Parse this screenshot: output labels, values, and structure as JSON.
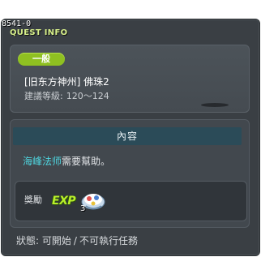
{
  "window": {
    "quest_id": "8541-0",
    "title": "QUEST INFO"
  },
  "quest": {
    "badge": "一般",
    "name": "[旧东方神州] 佛珠2",
    "level_label": "建議等級:",
    "level_value": "120～124"
  },
  "content": {
    "header": "內容",
    "npc": "海峰法师",
    "description_rest": "需要幫助。"
  },
  "reward": {
    "label": "獎勵",
    "exp_label": "EXP",
    "item_icon": "reward-item-icon",
    "item_qty": "3"
  },
  "status": {
    "label": "狀態:",
    "value1": "可開始",
    "separator": "/",
    "value2": "不可執行任務"
  },
  "colors": {
    "badge": "#8fc021",
    "title": "#d7f08a",
    "npc": "#4fd6e0",
    "exp": "#b8ef2a"
  }
}
